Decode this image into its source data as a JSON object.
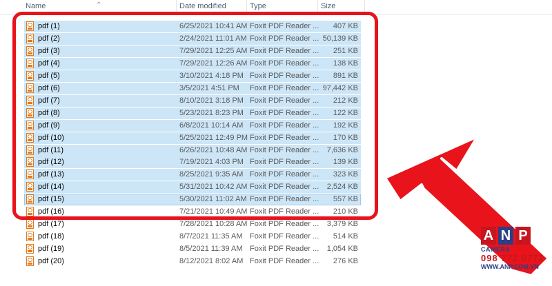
{
  "header": {
    "name": "Name",
    "date": "Date modified",
    "type": "Type",
    "size": "Size"
  },
  "files": [
    {
      "name": "pdf (1)",
      "date": "6/25/2021 10:41 AM",
      "type": "Foxit PDF Reader ...",
      "size": "407 KB",
      "selected": true
    },
    {
      "name": "pdf (2)",
      "date": "2/24/2021 11:01 AM",
      "type": "Foxit PDF Reader ...",
      "size": "50,139 KB",
      "selected": true
    },
    {
      "name": "pdf (3)",
      "date": "7/29/2021 12:25 AM",
      "type": "Foxit PDF Reader ...",
      "size": "251 KB",
      "selected": true
    },
    {
      "name": "pdf (4)",
      "date": "7/29/2021 12:26 AM",
      "type": "Foxit PDF Reader ...",
      "size": "138 KB",
      "selected": true
    },
    {
      "name": "pdf (5)",
      "date": "3/10/2021 4:18 PM",
      "type": "Foxit PDF Reader ...",
      "size": "891 KB",
      "selected": true
    },
    {
      "name": "pdf (6)",
      "date": "3/5/2021 4:51 PM",
      "type": "Foxit PDF Reader ...",
      "size": "97,442 KB",
      "selected": true
    },
    {
      "name": "pdf (7)",
      "date": "8/10/2021 3:18 PM",
      "type": "Foxit PDF Reader ...",
      "size": "212 KB",
      "selected": true
    },
    {
      "name": "pdf (8)",
      "date": "5/23/2021 8:23 PM",
      "type": "Foxit PDF Reader ...",
      "size": "122 KB",
      "selected": true
    },
    {
      "name": "pdf (9)",
      "date": "6/8/2021 10:14 AM",
      "type": "Foxit PDF Reader ...",
      "size": "192 KB",
      "selected": true
    },
    {
      "name": "pdf (10)",
      "date": "5/25/2021 12:49 PM",
      "type": "Foxit PDF Reader ...",
      "size": "170 KB",
      "selected": true
    },
    {
      "name": "pdf (11)",
      "date": "6/26/2021 10:48 AM",
      "type": "Foxit PDF Reader ...",
      "size": "7,636 KB",
      "selected": true
    },
    {
      "name": "pdf (12)",
      "date": "7/19/2021 4:03 PM",
      "type": "Foxit PDF Reader ...",
      "size": "139 KB",
      "selected": true
    },
    {
      "name": "pdf (13)",
      "date": "8/25/2021 9:35 AM",
      "type": "Foxit PDF Reader ...",
      "size": "323 KB",
      "selected": true
    },
    {
      "name": "pdf (14)",
      "date": "5/31/2021 10:42 AM",
      "type": "Foxit PDF Reader ...",
      "size": "2,524 KB",
      "selected": true
    },
    {
      "name": "pdf (15)",
      "date": "5/30/2021 11:02 AM",
      "type": "Foxit PDF Reader ...",
      "size": "557 KB",
      "selected": true
    },
    {
      "name": "pdf (16)",
      "date": "7/21/2021 10:49 AM",
      "type": "Foxit PDF Reader ...",
      "size": "210 KB",
      "selected": false
    },
    {
      "name": "pdf (17)",
      "date": "7/28/2021 10:28 AM",
      "type": "Foxit PDF Reader ...",
      "size": "3,379 KB",
      "selected": false
    },
    {
      "name": "pdf (18)",
      "date": "8/7/2021 11:35 AM",
      "type": "Foxit PDF Reader ...",
      "size": "514 KB",
      "selected": false
    },
    {
      "name": "pdf (19)",
      "date": "8/5/2021 11:39 AM",
      "type": "Foxit PDF Reader ...",
      "size": "1,054 KB",
      "selected": false
    },
    {
      "name": "pdf (20)",
      "date": "8/12/2021 8:02 AM",
      "type": "Foxit PDF Reader ...",
      "size": "276 KB",
      "selected": false
    }
  ],
  "logo": {
    "letters": [
      "A",
      "N",
      "P"
    ],
    "tagline": "CAMERA",
    "phone": "098 772 0772",
    "website": "WWW.ANP.COM.VN"
  },
  "colors": {
    "selection": "#cde6f7",
    "highlight_border": "#e8131b",
    "arrow": "#e8131b",
    "pdf_icon": "#e07b1e"
  },
  "icons": {
    "file": "foxit-pdf-file-icon",
    "sort": "sort-up-chevron-icon",
    "annotation": "red-pointer-arrow"
  }
}
